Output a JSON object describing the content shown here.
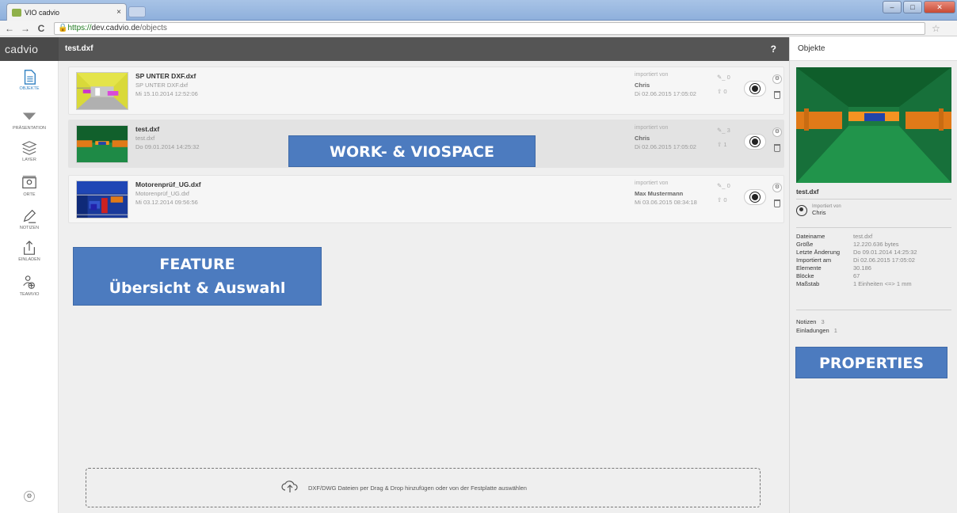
{
  "browser": {
    "tab_title": "VIO cadvio",
    "tab_close": "×",
    "url_scheme": "https://",
    "url_host": "dev.cadvio.de",
    "url_path": "/objects",
    "back": "←",
    "forward": "→",
    "reload": "C",
    "star": "☆"
  },
  "header": {
    "logo": "cadvio",
    "file_title": "test.dxf",
    "help": "?"
  },
  "sidebar": {
    "items": [
      {
        "label": "OBJEKTE",
        "icon": "document-icon",
        "active": true
      },
      {
        "label": "PRÄSENTATION",
        "icon": "triangle-down-icon",
        "active": false
      },
      {
        "label": "LAYER",
        "icon": "layers-icon",
        "active": false
      },
      {
        "label": "ORTE",
        "icon": "map-pin-icon",
        "active": false
      },
      {
        "label": "NOTIZEN",
        "icon": "pencil-icon",
        "active": false
      },
      {
        "label": "EINLADEN",
        "icon": "share-icon",
        "active": false
      },
      {
        "label": "TEAMVIO",
        "icon": "team-icon",
        "active": false
      }
    ],
    "settings_icon": "gear-icon"
  },
  "objects": [
    {
      "name": "SP UNTER DXF.dxf",
      "file": "SP UNTER DXF.dxf",
      "date": "Mi 15.10.2014 12:52:06",
      "imported_label": "importiert von",
      "imported_by": "Chris",
      "imported_date": "Di 02.06.2015 17:05:02",
      "notes": "0",
      "invites": "0",
      "selected": false
    },
    {
      "name": "test.dxf",
      "file": "test.dxf",
      "date": "Do 09.01.2014 14:25:32",
      "imported_label": "importiert von",
      "imported_by": "Chris",
      "imported_date": "Di 02.06.2015 17:05:02",
      "notes": "3",
      "invites": "1",
      "selected": true
    },
    {
      "name": "Motorenprüf_UG.dxf",
      "file": "Motorenprüf_UG.dxf",
      "date": "Mi 03.12.2014 09:56:56",
      "imported_label": "importiert von",
      "imported_by": "Max Mustermann",
      "imported_date": "Mi 03.06.2015 08:34:18",
      "notes": "0",
      "invites": "0",
      "selected": false
    }
  ],
  "overlays": {
    "workspace": "WORK- & VIOSPACE",
    "feature_line1": "FEATURE",
    "feature_line2": "Übersicht & Auswahl",
    "properties": "PROPERTIES"
  },
  "dropzone": {
    "text": "DXF/DWG Dateien per Drag & Drop hinzufügen oder von der Festplatte auswählen",
    "icon": "cloud-upload-icon"
  },
  "properties": {
    "title": "Objekte",
    "file": "test.dxf",
    "imported_label": "Importiert von",
    "imported_by": "Chris",
    "rows": [
      {
        "k": "Dateiname",
        "v": "test.dxf"
      },
      {
        "k": "Größe",
        "v": "12.220.636 bytes"
      },
      {
        "k": "Letzte Änderung",
        "v": "Do 09.01.2014 14:25:32"
      },
      {
        "k": "Importiert am",
        "v": "Di 02.06.2015 17:05:02"
      },
      {
        "k": "Elemente",
        "v": "30.186"
      },
      {
        "k": "Blöcke",
        "v": "67"
      },
      {
        "k": "Maßstab",
        "v": "1 Einheiten   <=>   1 mm"
      }
    ],
    "counts": [
      {
        "k": "Notizen",
        "v": "3"
      },
      {
        "k": "Einladungen",
        "v": "1"
      }
    ]
  },
  "colors": {
    "accent": "#2d7fc1",
    "header": "#555555",
    "overlay": "#4c7bbf"
  }
}
